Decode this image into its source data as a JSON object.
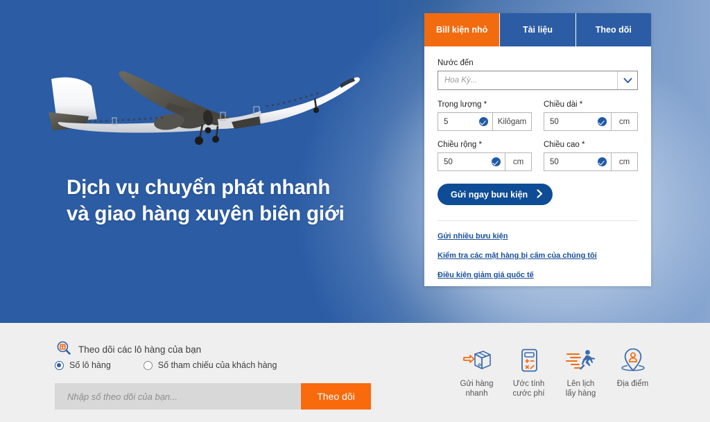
{
  "hero": {
    "title": "Dịch vụ chuyển phát nhanh\nvà giao hàng xuyên biên giới",
    "image_name": "airplane-photo",
    "bg_color": "#2b5ca4"
  },
  "card": {
    "tabs": [
      {
        "label": "Bill kiện nhỏ",
        "active": true
      },
      {
        "label": "Tài liệu",
        "active": false
      },
      {
        "label": "Theo dõi",
        "active": false
      }
    ],
    "country": {
      "label": "Nước đến",
      "value": "",
      "placeholder": "Hoa Kỳ..."
    },
    "fields": [
      {
        "label": "Trọng lượng *",
        "value": "5",
        "unit": "Kilôgam",
        "valid": true
      },
      {
        "label": "Chiều dài *",
        "value": "50",
        "unit": "cm",
        "valid": true
      },
      {
        "label": "Chiều rộng *",
        "value": "50",
        "unit": "cm",
        "valid": true
      },
      {
        "label": "Chiều cao *",
        "value": "50",
        "unit": "cm",
        "valid": true
      }
    ],
    "cta_label": "Gửi ngay bưu kiện",
    "links": [
      "Gửi nhiều bưu kiện",
      "Kiểm tra các mặt hàng bị cấm của chúng tôi",
      "Điều kiện giảm giá quốc tế"
    ],
    "accent_orange": "#f26b0f",
    "accent_blue": "#2c5ca4"
  },
  "footer": {
    "track_heading": "Theo dõi các lô hàng của bạn",
    "track_icon": "package-search-icon",
    "radios": [
      {
        "label": "Số lô hàng",
        "selected": true
      },
      {
        "label": "Số tham chiếu của khách hàng",
        "selected": false
      }
    ],
    "search": {
      "value": "",
      "placeholder": "Nhập số theo dõi của bạn...",
      "button_label": "Theo dõi"
    },
    "services": [
      {
        "icon": "box-arrow-icon",
        "label": "Gửi hàng\nnhanh"
      },
      {
        "icon": "calculator-icon",
        "label": "Ước tính\ncước phí"
      },
      {
        "icon": "running-man-icon",
        "label": "Lên lịch\nlấy hàng"
      },
      {
        "icon": "location-pin-person-icon",
        "label": "Địa điểm"
      }
    ]
  }
}
